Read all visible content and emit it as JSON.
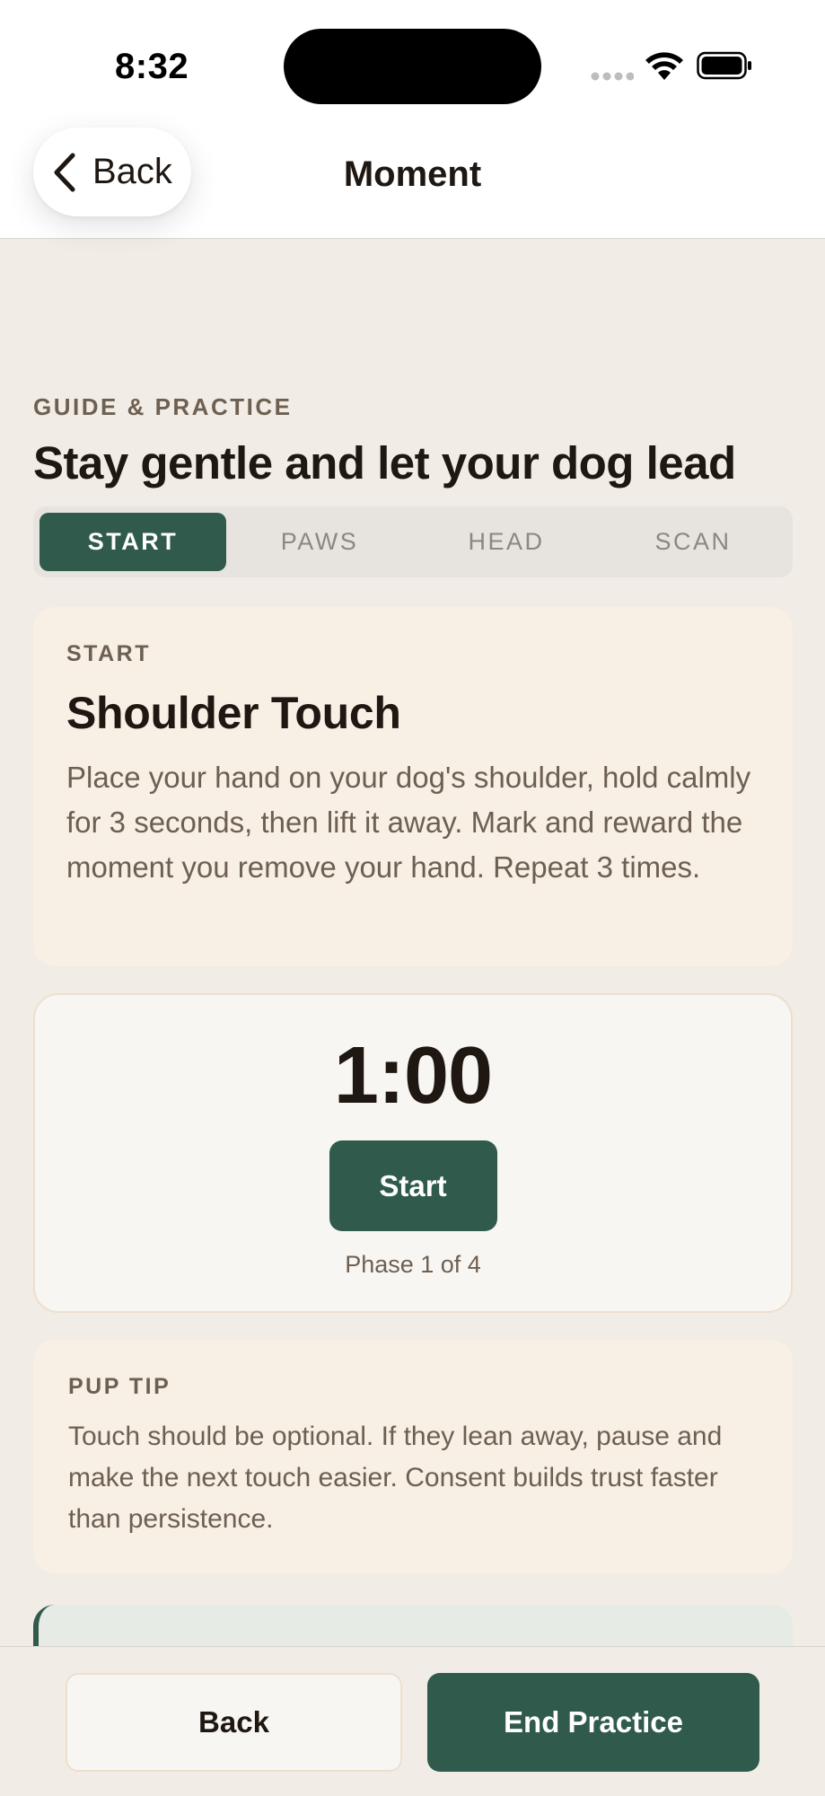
{
  "status_bar": {
    "time": "8:32"
  },
  "nav": {
    "back_label": "Back",
    "title": "Moment"
  },
  "header": {
    "eyebrow": "GUIDE & PRACTICE",
    "title": "Stay gentle and let your dog lead"
  },
  "tabs": [
    {
      "label": "START",
      "active": true
    },
    {
      "label": "PAWS",
      "active": false
    },
    {
      "label": "HEAD",
      "active": false
    },
    {
      "label": "SCAN",
      "active": false
    }
  ],
  "step": {
    "eyebrow": "START",
    "title": "Shoulder Touch",
    "description": "Place your hand on your dog's shoulder, hold calmly for 3 seconds, then lift it away. Mark and reward the moment you remove your hand. Repeat 3 times."
  },
  "timer": {
    "value": "1:00",
    "start_label": "Start",
    "phase": "Phase 1 of 4"
  },
  "tip": {
    "eyebrow": "PUP TIP",
    "text": "Touch should be optional. If they lean away, pause and make the next touch easier. Consent builds trust faster than persistence."
  },
  "footer": {
    "back_label": "Back",
    "end_label": "End Practice"
  },
  "colors": {
    "accent": "#2F5A4C",
    "background": "#F1ECE5",
    "card": "#F8EFE5",
    "text": "#1E1712",
    "muted_text": "#6D6052"
  },
  "icons": {
    "nav_back": "chevron-left-icon",
    "wifi": "wifi-icon",
    "battery": "battery-icon",
    "signal": "cellular-signal-icon"
  }
}
